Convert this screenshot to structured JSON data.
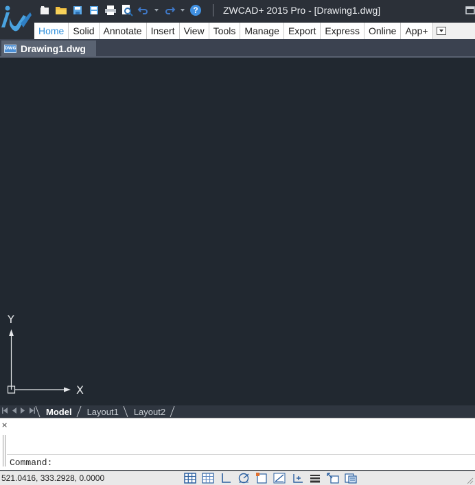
{
  "window": {
    "title": "ZWCAD+ 2015 Pro - [Drawing1.dwg]"
  },
  "quick_access": [
    {
      "icon": "new-file-icon"
    },
    {
      "icon": "open-folder-icon"
    },
    {
      "icon": "save-icon"
    },
    {
      "icon": "save-as-icon"
    },
    {
      "icon": "print-icon"
    },
    {
      "icon": "print-preview-icon"
    },
    {
      "icon": "undo-icon"
    },
    {
      "icon": "redo-icon"
    },
    {
      "icon": "help-icon"
    }
  ],
  "ribbon": {
    "tabs": [
      "Home",
      "Solid",
      "Annotate",
      "Insert",
      "View",
      "Tools",
      "Manage",
      "Export",
      "Express",
      "Online",
      "App+"
    ],
    "active_tab": "Home"
  },
  "document_tab": {
    "label": "Drawing1.dwg",
    "icon_text": "DWG"
  },
  "ucs": {
    "x_label": "X",
    "y_label": "Y"
  },
  "layout_tabs": {
    "tabs": [
      "Model",
      "Layout1",
      "Layout2"
    ],
    "active": "Model"
  },
  "command": {
    "close_label": "×",
    "prompt": "Command:",
    "input_value": ""
  },
  "status": {
    "coordinates": "521.0416,  333.2928, 0.0000",
    "buttons": [
      "snap-grid-icon",
      "grid-display-icon",
      "ortho-icon",
      "polar-tracking-icon",
      "object-snap-icon",
      "object-snap-tracking-icon",
      "dynamic-ucs-icon",
      "lineweight-icon",
      "dynamic-input-icon",
      "quick-properties-icon"
    ]
  },
  "colors": {
    "canvas": "#212830",
    "accent": "#2d8fdc",
    "titlebar": "#2b3038"
  }
}
